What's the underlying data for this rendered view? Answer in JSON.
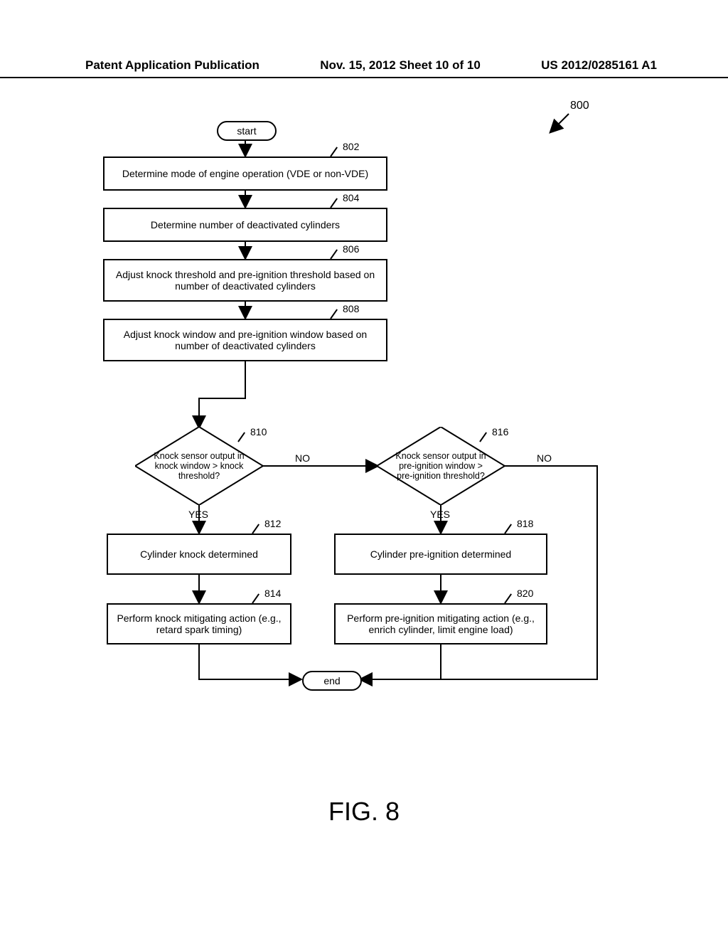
{
  "header": {
    "left": "Patent Application Publication",
    "center": "Nov. 15, 2012  Sheet 10 of 10",
    "right": "US 2012/0285161 A1"
  },
  "figure_ref": "800",
  "nodes": {
    "start": "start",
    "end": "end",
    "n802": "Determine mode of engine operation (VDE or non-VDE)",
    "n804": "Determine number of deactivated cylinders",
    "n806": "Adjust knock threshold and pre-ignition threshold based on number of deactivated cylinders",
    "n808": "Adjust knock window and pre-ignition window based on number of deactivated cylinders",
    "n810": "Knock sensor output in knock window > knock threshold?",
    "n812": "Cylinder knock determined",
    "n814": "Perform knock mitigating action (e.g., retard spark timing)",
    "n816": "Knock sensor output in pre-ignition window > pre-ignition threshold?",
    "n818": "Cylinder pre-ignition determined",
    "n820": "Perform pre-ignition mitigating action (e.g., enrich cylinder, limit engine load)"
  },
  "refs": {
    "r802": "802",
    "r804": "804",
    "r806": "806",
    "r808": "808",
    "r810": "810",
    "r812": "812",
    "r814": "814",
    "r816": "816",
    "r818": "818",
    "r820": "820"
  },
  "labels": {
    "yes": "YES",
    "no": "NO"
  },
  "caption": "FIG. 8"
}
